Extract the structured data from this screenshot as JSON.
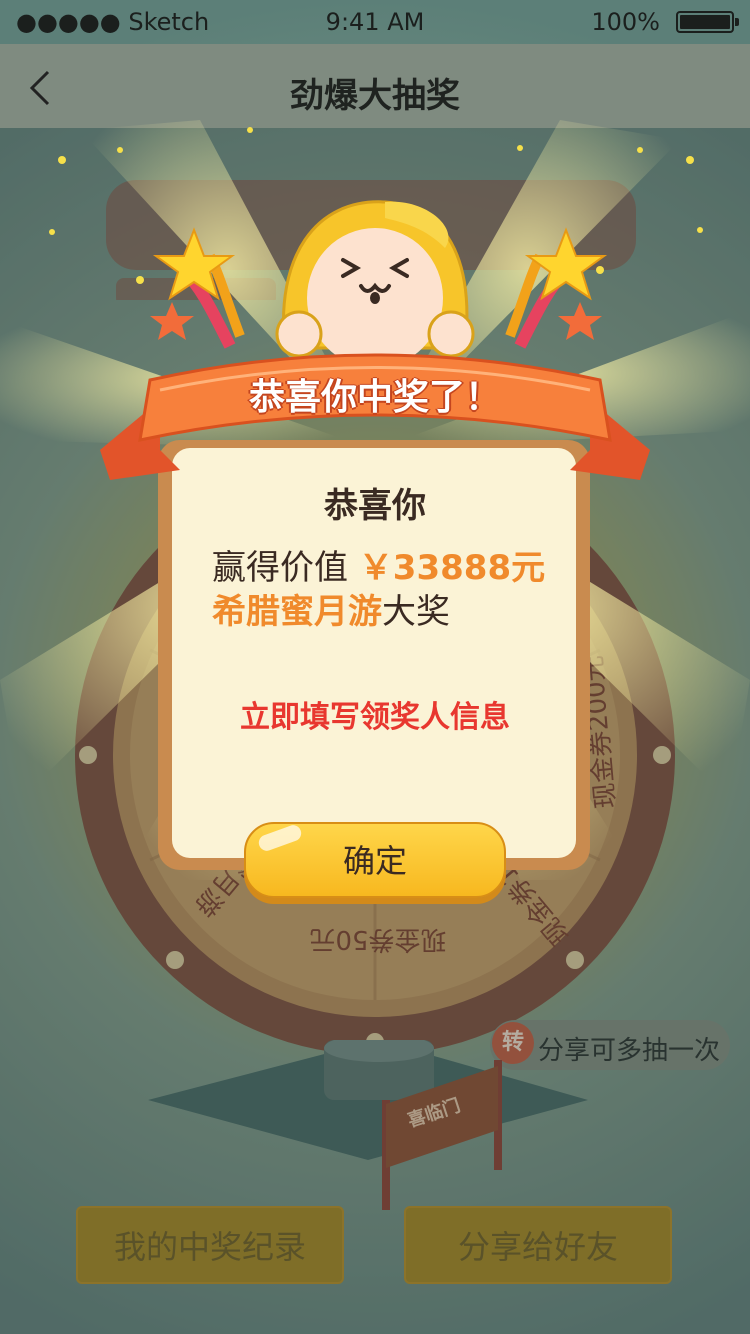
{
  "status_bar": {
    "carrier": "●●●●● Sketch",
    "time": "9:41 AM",
    "battery_percent": "100%"
  },
  "nav": {
    "title": "劲爆大抽奖",
    "back_icon": "chevron-left-icon"
  },
  "background": {
    "wheel_labels": [
      "现金券50元",
      "现金券100元",
      "现金券200元",
      "蜜月游"
    ],
    "share_hint": "分享可多抽一次",
    "share_icon_text": "转",
    "sign_text": "喜临门",
    "buttons": {
      "records": "我的中奖纪录",
      "share": "分享给好友"
    }
  },
  "dialog": {
    "ribbon_title": "恭喜你中奖了！",
    "heading": "恭喜你",
    "win_prefix": "赢得价值",
    "prize_value": "￥33888元",
    "prize_name": "希腊蜜月游",
    "prize_suffix": "大奖",
    "fill_info_link": "立即填写领奖人信息",
    "confirm_label": "确定"
  },
  "colors": {
    "accent_orange": "#f08a2c",
    "link_red": "#e8372f",
    "ribbon_orange": "#f26c3a",
    "card_cream": "#fbf3d6",
    "button_yellow": "#ffcb35"
  }
}
